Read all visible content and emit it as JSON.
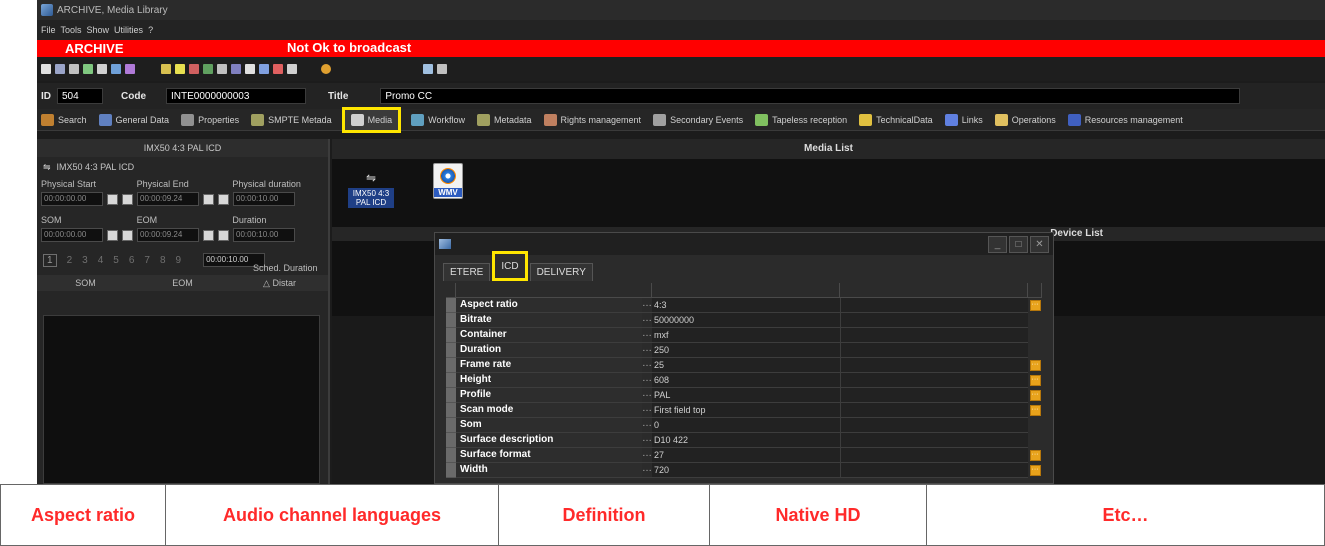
{
  "window": {
    "title": "ARCHIVE, Media Library"
  },
  "menu": [
    "File",
    "Tools",
    "Show",
    "Utilities",
    "?"
  ],
  "banner": {
    "left": "ARCHIVE",
    "status": "Not Ok to broadcast"
  },
  "record": {
    "id_label": "ID",
    "id_value": "504",
    "code_label": "Code",
    "code_value": "INTE0000000003",
    "title_label": "Title",
    "title_value": "Promo CC"
  },
  "tabs": [
    "Search",
    "General Data",
    "Properties",
    "SMPTE Metada",
    "Media",
    "Workflow",
    "Metadata",
    "Rights management",
    "Secondary Events",
    "Tapeless reception",
    "TechnicalData",
    "Links",
    "Operations",
    "Resources management"
  ],
  "left_panel": {
    "header": "IMX50 4:3 PAL ICD",
    "item": "IMX50 4:3 PAL ICD",
    "row1_labels": [
      "Physical Start",
      "Physical End",
      "Physical duration"
    ],
    "row1_values": [
      "00:00:00.00",
      "00:00:09.24",
      "00:00:10.00"
    ],
    "row2_labels": [
      "SOM",
      "EOM",
      "Duration"
    ],
    "row2_values": [
      "00:00:00.00",
      "00:00:09.24",
      "00:00:10.00"
    ],
    "sched_label": "Sched. Duration",
    "sched_value": "00:00:10.00",
    "pages": [
      "1",
      "2",
      "3",
      "4",
      "5",
      "6",
      "7",
      "8",
      "9"
    ],
    "grid_headers": [
      "SOM",
      "EOM",
      "△ Distar"
    ]
  },
  "media": {
    "header": "Media List",
    "item1": "IMX50 4:3 PAL ICD",
    "item2": "WMV",
    "device_header": "Device List"
  },
  "dialog": {
    "tabs": [
      "ETERE",
      "ICD",
      "DELIVERY"
    ],
    "active_tab": "ICD",
    "rows": [
      {
        "key": "Aspect ratio",
        "value": "4:3",
        "button": true
      },
      {
        "key": "Bitrate",
        "value": "50000000",
        "button": false
      },
      {
        "key": "Container",
        "value": "mxf",
        "button": false
      },
      {
        "key": "Duration",
        "value": "250",
        "button": false
      },
      {
        "key": "Frame rate",
        "value": "25",
        "button": true
      },
      {
        "key": "Height",
        "value": "608",
        "button": true
      },
      {
        "key": "Profile",
        "value": "PAL",
        "button": true
      },
      {
        "key": "Scan mode",
        "value": "First field top",
        "button": true
      },
      {
        "key": "Som",
        "value": "0",
        "button": false
      },
      {
        "key": "Surface description",
        "value": "D10 422",
        "button": false
      },
      {
        "key": "Surface format",
        "value": "27",
        "button": true
      },
      {
        "key": "Width",
        "value": "720",
        "button": true
      }
    ]
  },
  "bottom_table": [
    "Aspect ratio",
    "Audio channel languages",
    "Definition",
    "Native HD",
    "Etc…"
  ],
  "colors": {
    "banner": "#ff0000",
    "highlight": "#ffe600",
    "table_text": "#ff2a2a"
  }
}
